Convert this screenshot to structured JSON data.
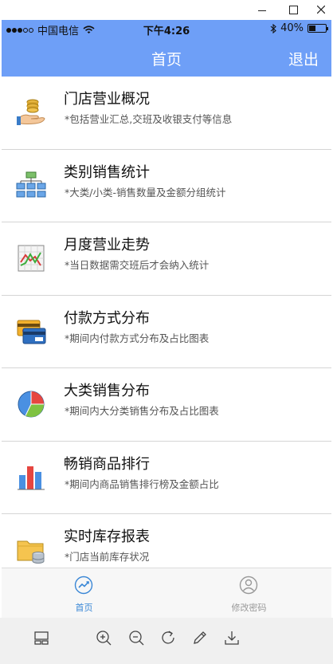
{
  "window": {
    "minimize": "minimize",
    "maximize": "maximize",
    "close": "close"
  },
  "status_bar": {
    "carrier": "中国电信",
    "time": "下午4:26",
    "battery": "40%",
    "battery_level": 0.4,
    "signal_bars_filled": 3,
    "signal_bars_total": 5
  },
  "nav": {
    "title": "首页",
    "logout": "退出"
  },
  "menu": [
    {
      "title": "门店营业概况",
      "desc": "*包括营业汇总,交班及收银支付等信息",
      "icon": "coins-hand-icon"
    },
    {
      "title": "类别销售统计",
      "desc": "*大类/小类-销售数量及金额分组统计",
      "icon": "hierarchy-icon"
    },
    {
      "title": "月度营业走势",
      "desc": "*当日数据需交班后才会纳入统计",
      "icon": "line-chart-icon"
    },
    {
      "title": "付款方式分布",
      "desc": "*期间内付款方式分布及占比图表",
      "icon": "credit-cards-icon"
    },
    {
      "title": "大类销售分布",
      "desc": "*期间内大分类销售分布及占比图表",
      "icon": "pie-chart-icon"
    },
    {
      "title": "畅销商品排行",
      "desc": "*期间内商品销售排行榜及金额占比",
      "icon": "bar-chart-icon"
    },
    {
      "title": "实时库存报表",
      "desc": "*门店当前库存状况",
      "icon": "folder-database-icon"
    }
  ],
  "tabs": [
    {
      "label": "首页",
      "icon": "trend-icon",
      "active": true
    },
    {
      "label": "修改密码",
      "icon": "user-icon",
      "active": false
    }
  ],
  "toolbar": [
    {
      "icon": "layout-icon"
    },
    {
      "icon": "zoom-in-icon"
    },
    {
      "icon": "zoom-out-icon"
    },
    {
      "icon": "rotate-icon"
    },
    {
      "icon": "pen-icon"
    },
    {
      "icon": "download-icon"
    }
  ],
  "colors": {
    "nav_background": "#6e9ff7",
    "tab_active": "#3a87d6",
    "tab_inactive": "#999999"
  }
}
